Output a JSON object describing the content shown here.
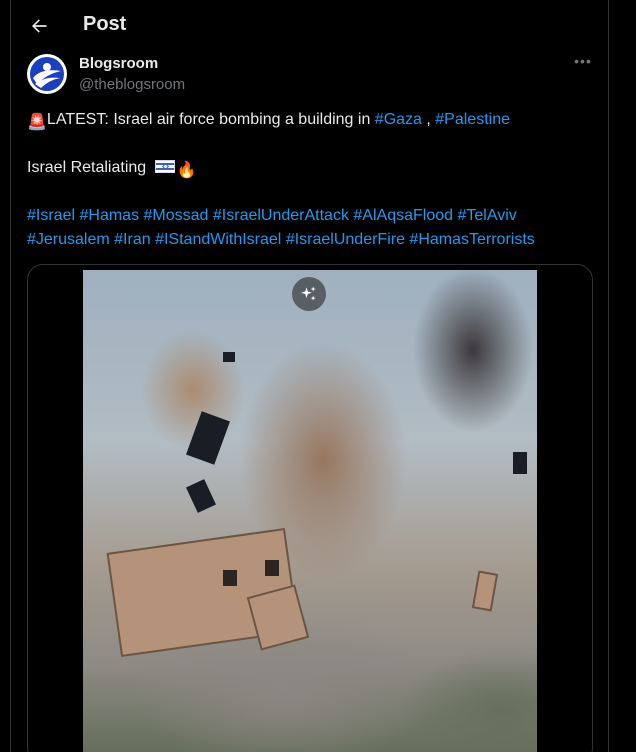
{
  "header": {
    "title": "Post",
    "back_icon": "arrow-left-icon"
  },
  "author": {
    "name": "Blogsroom",
    "handle": "@theblogsroom",
    "avatar_icon": "blogsroom-logo-icon"
  },
  "more_icon": "more-horizontal-icon",
  "tweet": {
    "line1": {
      "emoji": "🚨",
      "text": "LATEST: Israel air force bombing a building in ",
      "tag_gaza": "#Gaza",
      "sep": " , ",
      "tag_palestine": "#Palestine"
    },
    "line2": {
      "text": "Israel Retaliating ",
      "flag_icon": "israel-flag-icon",
      "fire": "🔥"
    },
    "hashtags_row1": [
      "#Israel",
      "#Hamas",
      "#Mossad",
      "#IsraelUnderAttack",
      "#AlAqsaFlood",
      "#TelAviv"
    ],
    "hashtags_row2": [
      "#Jerusalem",
      "#Iran",
      "#IStandWithIsrael",
      "#IsraelUnderFire",
      "#HamasTerrorists"
    ]
  },
  "media": {
    "type": "video",
    "enhance_icon": "sparkle-icon"
  },
  "colors": {
    "background": "#000000",
    "text": "#e7e9ea",
    "secondary": "#71767b",
    "link": "#1d9bf0",
    "border": "#2f3336"
  }
}
